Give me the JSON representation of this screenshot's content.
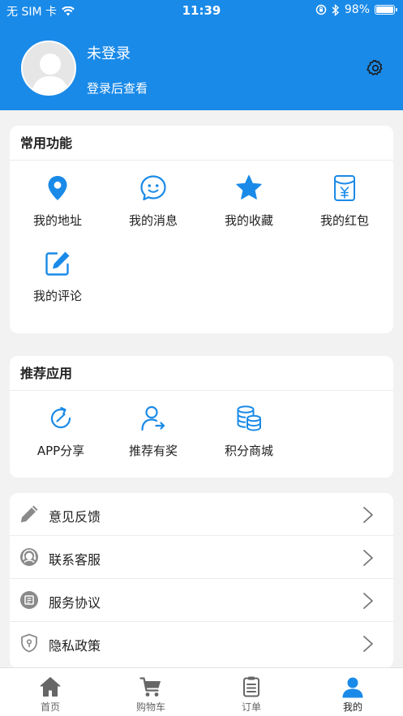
{
  "status_bar": {
    "carrier": "无 SIM 卡",
    "time": "11:39",
    "battery": "98%",
    "battery_level": 0.98
  },
  "profile": {
    "name": "未登录",
    "subtitle": "登录后查看"
  },
  "common_functions": {
    "title": "常用功能",
    "items": [
      {
        "label": "我的地址",
        "icon": "location-pin-icon"
      },
      {
        "label": "我的消息",
        "icon": "chat-bubble-icon"
      },
      {
        "label": "我的收藏",
        "icon": "star-icon"
      },
      {
        "label": "我的红包",
        "icon": "red-envelope-icon"
      },
      {
        "label": "我的评论",
        "icon": "edit-icon"
      }
    ]
  },
  "recommended_apps": {
    "title": "推荐应用",
    "items": [
      {
        "label": "APP分享",
        "icon": "share-icon"
      },
      {
        "label": "推荐有奖",
        "icon": "user-refer-icon"
      },
      {
        "label": "积分商城",
        "icon": "coins-icon"
      }
    ]
  },
  "menu_list": [
    {
      "label": "意见反馈",
      "icon": "pencil-icon"
    },
    {
      "label": "联系客服",
      "icon": "headset-icon"
    },
    {
      "label": "服务协议",
      "icon": "agreement-icon"
    },
    {
      "label": "隐私政策",
      "icon": "shield-icon"
    }
  ],
  "tabbar": [
    {
      "label": "首页",
      "icon": "home-icon"
    },
    {
      "label": "购物车",
      "icon": "cart-icon"
    },
    {
      "label": "订单",
      "icon": "order-list-icon"
    },
    {
      "label": "我的",
      "icon": "profile-icon"
    }
  ],
  "colors": {
    "primary": "#1a8ae8",
    "background": "#f2f2f2",
    "icon_gray": "#888888",
    "active_tab": "#1a8ae8"
  }
}
